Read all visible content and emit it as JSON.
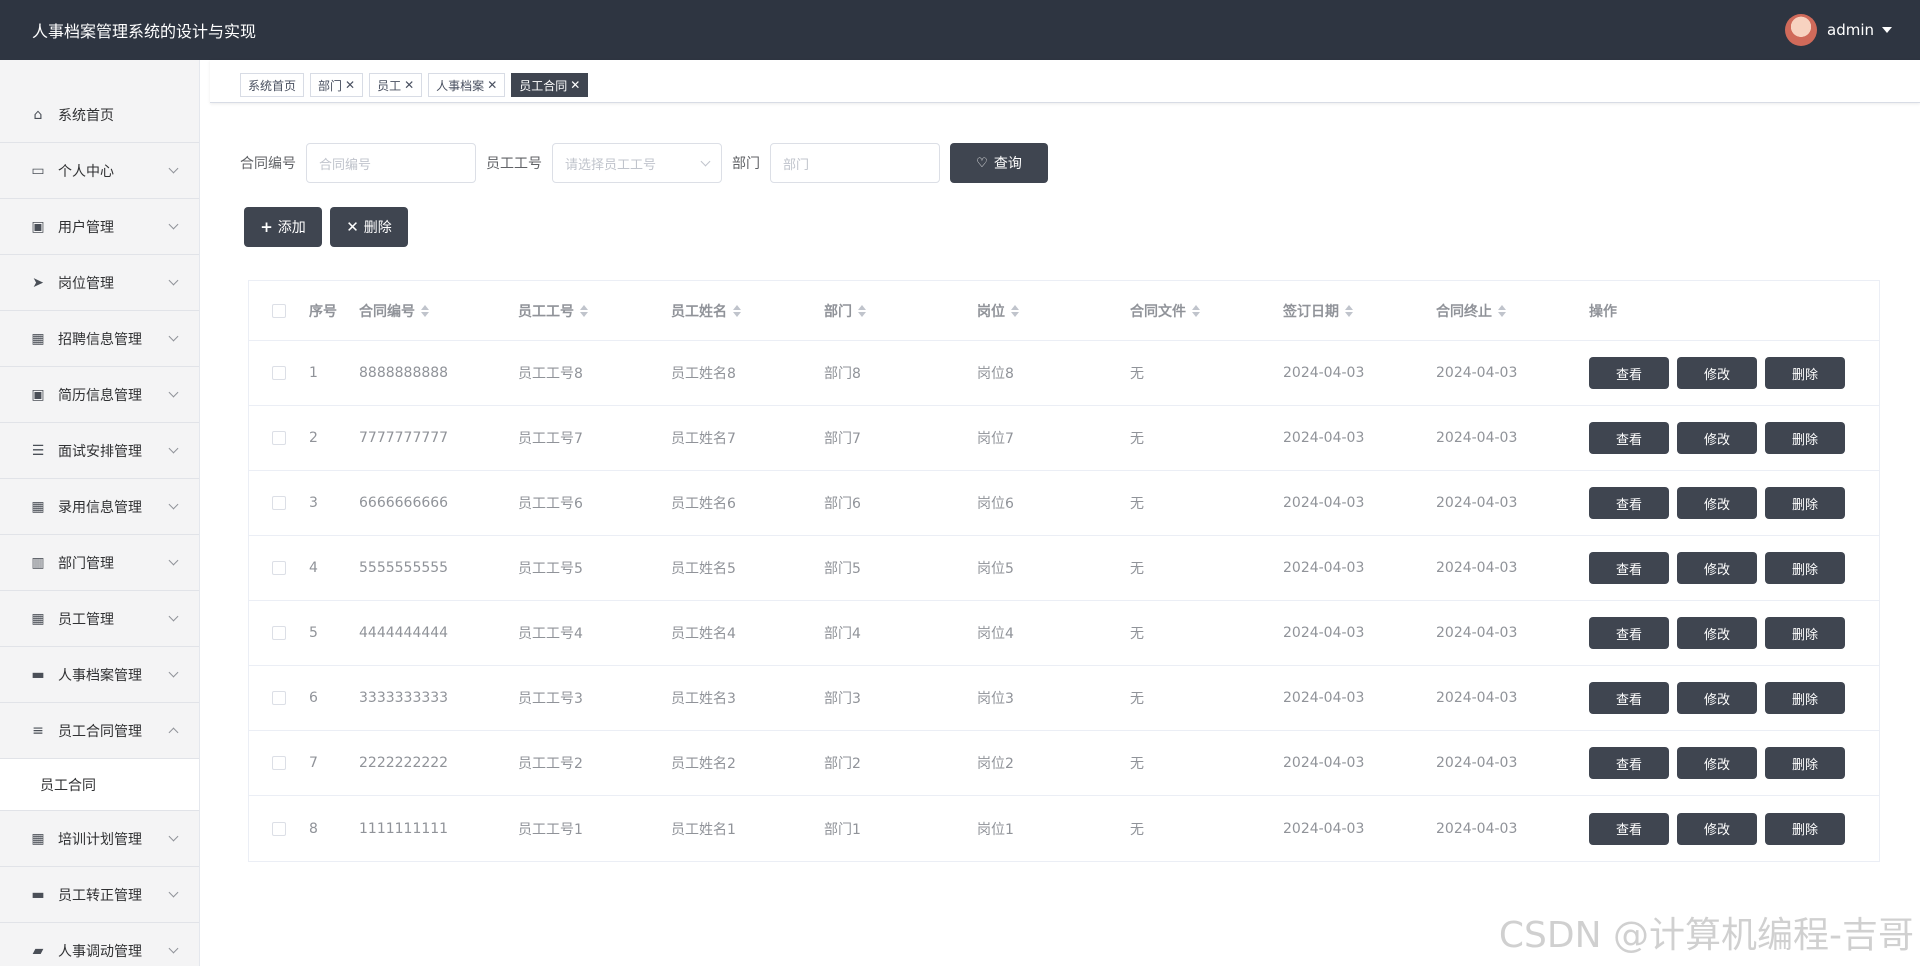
{
  "header": {
    "title": "人事档案管理系统的设计与实现",
    "username": "admin"
  },
  "sidebar": {
    "items": [
      {
        "label": "系统首页",
        "icon": "home-icon",
        "expandable": false
      },
      {
        "label": "个人中心",
        "icon": "credit-card-icon",
        "expandable": true
      },
      {
        "label": "用户管理",
        "icon": "clipboard-icon",
        "expandable": true
      },
      {
        "label": "岗位管理",
        "icon": "paper-plane-icon",
        "expandable": true
      },
      {
        "label": "招聘信息管理",
        "icon": "grid-icon",
        "expandable": true
      },
      {
        "label": "简历信息管理",
        "icon": "clipboard-check-icon",
        "expandable": true
      },
      {
        "label": "面试安排管理",
        "icon": "list-icon",
        "expandable": true
      },
      {
        "label": "录用信息管理",
        "icon": "grid-icon",
        "expandable": true
      },
      {
        "label": "部门管理",
        "icon": "book-icon",
        "expandable": true
      },
      {
        "label": "员工管理",
        "icon": "grid-9-icon",
        "expandable": true
      },
      {
        "label": "人事档案管理",
        "icon": "briefcase-icon",
        "expandable": true
      },
      {
        "label": "员工合同管理",
        "icon": "sliders-icon",
        "expandable": true,
        "open": true
      },
      {
        "label": "培训计划管理",
        "icon": "grid-icon",
        "expandable": true
      },
      {
        "label": "员工转正管理",
        "icon": "chat-icon",
        "expandable": true
      },
      {
        "label": "人事调动管理",
        "icon": "ticket-icon",
        "expandable": true
      }
    ],
    "submenu_label": "员工合同"
  },
  "tabs": [
    {
      "label": "系统首页",
      "closable": false
    },
    {
      "label": "部门",
      "closable": true
    },
    {
      "label": "员工",
      "closable": true
    },
    {
      "label": "人事档案",
      "closable": true
    },
    {
      "label": "员工合同",
      "closable": true,
      "active": true
    }
  ],
  "search": {
    "contract_no_label": "合同编号",
    "contract_no_placeholder": "合同编号",
    "employee_id_label": "员工工号",
    "employee_id_placeholder": "请选择员工工号",
    "dept_label": "部门",
    "dept_placeholder": "部门",
    "query_button": "查询"
  },
  "actions": {
    "add": "添加",
    "delete": "删除"
  },
  "table": {
    "columns": [
      "序号",
      "合同编号",
      "员工工号",
      "员工姓名",
      "部门",
      "岗位",
      "合同文件",
      "签订日期",
      "合同终止",
      "操作"
    ],
    "rows": [
      [
        "1",
        "8888888888",
        "员工工号8",
        "员工姓名8",
        "部门8",
        "岗位8",
        "无",
        "2024-04-03",
        "2024-04-03"
      ],
      [
        "2",
        "7777777777",
        "员工工号7",
        "员工姓名7",
        "部门7",
        "岗位7",
        "无",
        "2024-04-03",
        "2024-04-03"
      ],
      [
        "3",
        "6666666666",
        "员工工号6",
        "员工姓名6",
        "部门6",
        "岗位6",
        "无",
        "2024-04-03",
        "2024-04-03"
      ],
      [
        "4",
        "5555555555",
        "员工工号5",
        "员工姓名5",
        "部门5",
        "岗位5",
        "无",
        "2024-04-03",
        "2024-04-03"
      ],
      [
        "5",
        "4444444444",
        "员工工号4",
        "员工姓名4",
        "部门4",
        "岗位4",
        "无",
        "2024-04-03",
        "2024-04-03"
      ],
      [
        "6",
        "3333333333",
        "员工工号3",
        "员工姓名3",
        "部门3",
        "岗位3",
        "无",
        "2024-04-03",
        "2024-04-03"
      ],
      [
        "7",
        "2222222222",
        "员工工号2",
        "员工姓名2",
        "部门2",
        "岗位2",
        "无",
        "2024-04-03",
        "2024-04-03"
      ],
      [
        "8",
        "1111111111",
        "员工工号1",
        "员工姓名1",
        "部门1",
        "岗位1",
        "无",
        "2024-04-03",
        "2024-04-03"
      ]
    ],
    "row_actions": [
      "查看",
      "修改",
      "删除"
    ]
  },
  "watermark": "CSDN @计算机编程-吉哥",
  "colors": {
    "header_bg": "#2e3541",
    "button_dark": "#3f4550",
    "sidebar_bg": "#f4f4f5"
  }
}
